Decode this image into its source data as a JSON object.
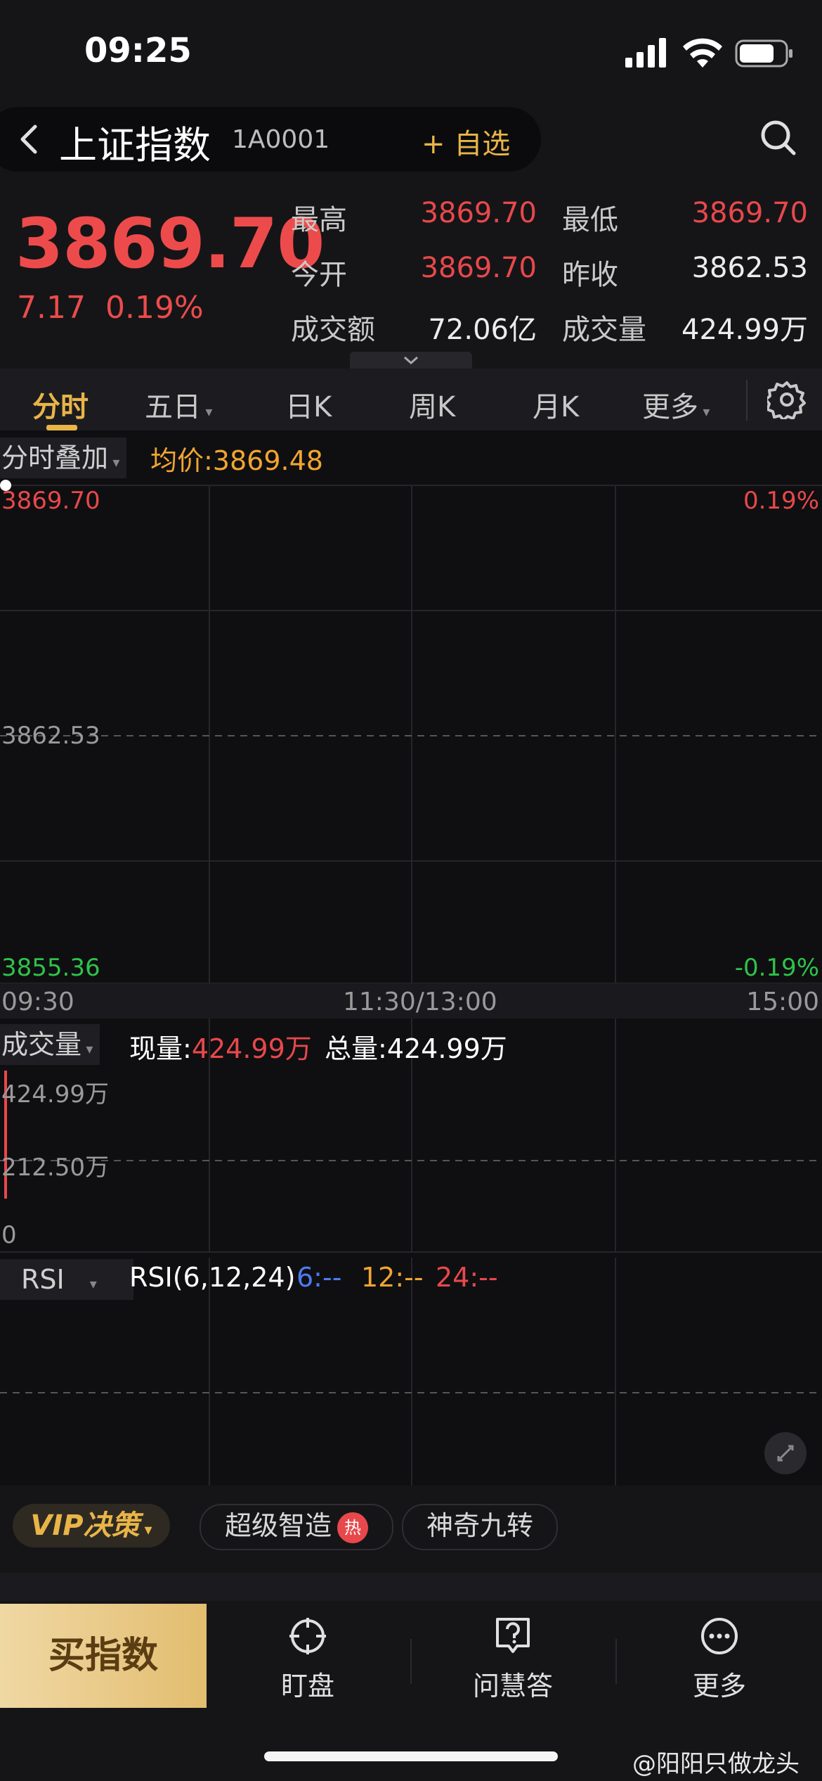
{
  "status_bar": {
    "time": "09:25"
  },
  "header": {
    "title": "上证指数",
    "code": "1A0001",
    "add_watch": "+ 自选"
  },
  "quote": {
    "price": "3869.70",
    "change": "7.17",
    "change_pct": "0.19%",
    "stats": [
      {
        "label": "最高",
        "value": "3869.70",
        "tone": "red"
      },
      {
        "label": "最低",
        "value": "3869.70",
        "tone": "red"
      },
      {
        "label": "今开",
        "value": "3869.70",
        "tone": "red"
      },
      {
        "label": "昨收",
        "value": "3862.53",
        "tone": "white"
      },
      {
        "label": "成交额",
        "value": "72.06亿",
        "tone": "white"
      },
      {
        "label": "成交量",
        "value": "424.99万",
        "tone": "white"
      }
    ]
  },
  "tabs": [
    {
      "label": "分时",
      "active": true
    },
    {
      "label": "五日",
      "dropdown": true
    },
    {
      "label": "日K"
    },
    {
      "label": "周K"
    },
    {
      "label": "月K"
    },
    {
      "label": "更多",
      "dropdown": true
    }
  ],
  "intraday": {
    "overlay_label": "分时叠加",
    "avg_label": "均价:3869.48",
    "y_high": "3869.70",
    "y_mid": "3862.53",
    "y_low": "3855.36",
    "pct_high": "0.19%",
    "pct_low": "-0.19%",
    "time_labels": [
      "09:30",
      "11:30/13:00",
      "15:00"
    ]
  },
  "volume": {
    "label": "成交量",
    "now_label": "现量:",
    "now_value": "424.99万",
    "total_label": "总量:",
    "total_value": "424.99万",
    "y_top": "424.99万",
    "y_mid": "212.50万",
    "y_zero": "0"
  },
  "rsi": {
    "label": "RSI",
    "params": "RSI(6,12,24)",
    "v6": "6:--",
    "v12": "12:--",
    "v24": "24:--"
  },
  "strategy": {
    "vip_label": "VIP决策",
    "pill1": "超级智造",
    "hot": "热",
    "pill2": "神奇九转"
  },
  "bottom_nav": {
    "buy": "买指数",
    "items": [
      {
        "label": "盯盘"
      },
      {
        "label": "问慧答"
      },
      {
        "label": "更多"
      }
    ]
  },
  "watermark": "@阳阳只做龙头",
  "colors": {
    "up": "#e8484b",
    "down": "#2fc24a",
    "accent": "#e9b548",
    "avg": "#f2a531"
  }
}
